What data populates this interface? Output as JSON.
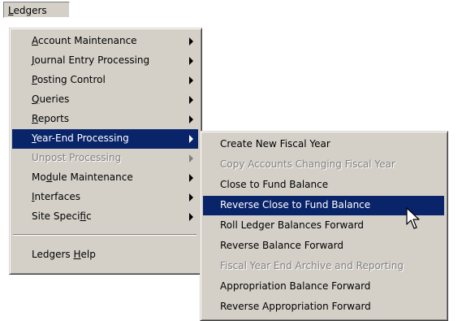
{
  "menubar": {
    "ledgers": {
      "before": "",
      "key": "L",
      "after": "edgers"
    }
  },
  "main_menu": {
    "items": [
      {
        "before": "",
        "key": "A",
        "after": "ccount Maintenance",
        "has_submenu": true,
        "enabled": true,
        "highlighted": false
      },
      {
        "before": "",
        "key": "J",
        "after": "ournal Entry Processing",
        "has_submenu": true,
        "enabled": true,
        "highlighted": false
      },
      {
        "before": "",
        "key": "P",
        "after": "osting Control",
        "has_submenu": true,
        "enabled": true,
        "highlighted": false
      },
      {
        "before": "",
        "key": "Q",
        "after": "ueries",
        "has_submenu": true,
        "enabled": true,
        "highlighted": false
      },
      {
        "before": "",
        "key": "R",
        "after": "eports",
        "has_submenu": true,
        "enabled": true,
        "highlighted": false
      },
      {
        "before": "",
        "key": "Y",
        "after": "ear-End Processing",
        "has_submenu": true,
        "enabled": true,
        "highlighted": true
      },
      {
        "before": "Unpost Processing",
        "key": "",
        "after": "",
        "has_submenu": true,
        "enabled": false,
        "highlighted": false
      },
      {
        "before": "Mo",
        "key": "d",
        "after": "ule Maintenance",
        "has_submenu": true,
        "enabled": true,
        "highlighted": false
      },
      {
        "before": "",
        "key": "I",
        "after": "nterfaces",
        "has_submenu": true,
        "enabled": true,
        "highlighted": false
      },
      {
        "before": "Site Speci",
        "key": "f",
        "after": "ic",
        "has_submenu": true,
        "enabled": true,
        "highlighted": false
      }
    ],
    "help": {
      "before": "Ledgers ",
      "key": "H",
      "after": "elp"
    }
  },
  "submenu": {
    "items": [
      {
        "label": "Create New Fiscal Year",
        "enabled": true,
        "highlighted": false
      },
      {
        "label": "Copy Accounts Changing Fiscal Year",
        "enabled": false,
        "highlighted": false
      },
      {
        "label": "Close to Fund Balance",
        "enabled": true,
        "highlighted": false
      },
      {
        "label": "Reverse Close to Fund Balance",
        "enabled": true,
        "highlighted": true
      },
      {
        "label": "Roll Ledger Balances Forward",
        "enabled": true,
        "highlighted": false
      },
      {
        "label": "Reverse Balance Forward",
        "enabled": true,
        "highlighted": false
      },
      {
        "label": "Fiscal Year End Archive and Reporting",
        "enabled": false,
        "highlighted": false
      },
      {
        "label": "Appropriation Balance Forward",
        "enabled": true,
        "highlighted": false
      },
      {
        "label": "Reverse Appropriation Forward",
        "enabled": true,
        "highlighted": false
      }
    ]
  },
  "colors": {
    "menu_bg": "#d4d0c8",
    "highlight": "#0a246a",
    "disabled_text": "#808080"
  },
  "icons": {
    "submenu_arrow": "chevron-right-icon",
    "cursor": "mouse-pointer-icon"
  }
}
